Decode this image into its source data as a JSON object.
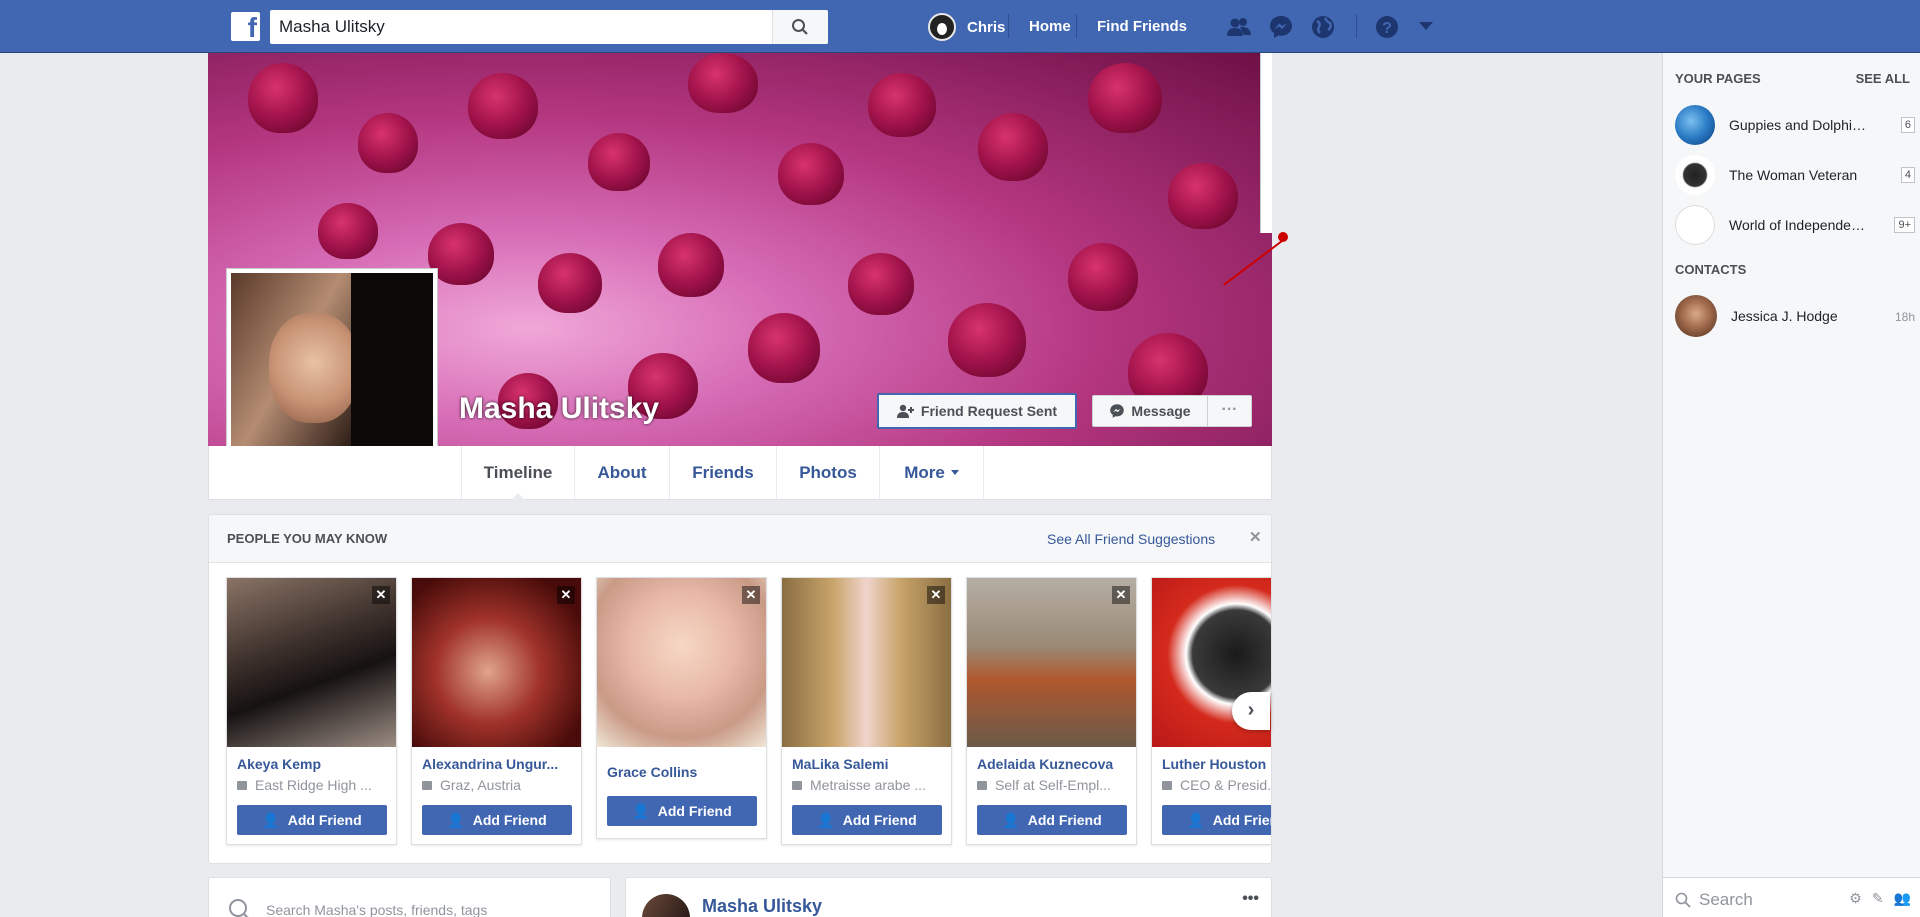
{
  "topbar": {
    "logo": "f",
    "search_value": "Masha Ulitsky",
    "user_name": "Chris",
    "home_label": "Home",
    "find_friends_label": "Find Friends",
    "icons": [
      "friend-requests-icon",
      "messenger-icon",
      "notifications-globe-icon",
      "help-icon",
      "account-caret-icon"
    ]
  },
  "profile": {
    "name": "Masha Ulitsky",
    "friend_request_label": "Friend Request Sent",
    "message_label": "Message",
    "more_label": "···"
  },
  "tabs": [
    "Timeline",
    "About",
    "Friends",
    "Photos",
    "More"
  ],
  "pymk": {
    "title": "PEOPLE YOU MAY KNOW",
    "see_all": "See All Friend Suggestions",
    "close": "✕",
    "add_label": "Add Friend",
    "people": [
      {
        "name": "Akeya Kemp",
        "sub": "East Ridge High ..."
      },
      {
        "name": "Alexandrina Ungur...",
        "sub": "Graz, Austria"
      },
      {
        "name": "Grace Collins",
        "sub": ""
      },
      {
        "name": "MaLika Salemi",
        "sub": "Metraisse arabe ..."
      },
      {
        "name": "Adelaida Kuznecova",
        "sub": "Self at Self-Empl..."
      },
      {
        "name": "Luther Houston",
        "sub": "CEO & Presid..."
      }
    ]
  },
  "bottom": {
    "search_placeholder": "Search Masha's posts, friends, tags",
    "post_author": "Masha Ulitsky",
    "post_menu": "•••"
  },
  "sidebar": {
    "pages_heading": "YOUR PAGES",
    "see_all": "SEE ALL",
    "pages": [
      {
        "name": "Guppies and Dolphins...",
        "count": "6"
      },
      {
        "name": "The Woman Veteran",
        "count": "4"
      },
      {
        "name": "World of Independence",
        "count": "9+"
      }
    ],
    "contacts_heading": "CONTACTS",
    "contacts": [
      {
        "name": "Jessica J. Hodge",
        "time": "18h"
      }
    ],
    "search_placeholder": "Search"
  },
  "colors": {
    "brand_blue": "#4267b2",
    "link_blue": "#365899",
    "page_bg": "#e9ebee"
  }
}
